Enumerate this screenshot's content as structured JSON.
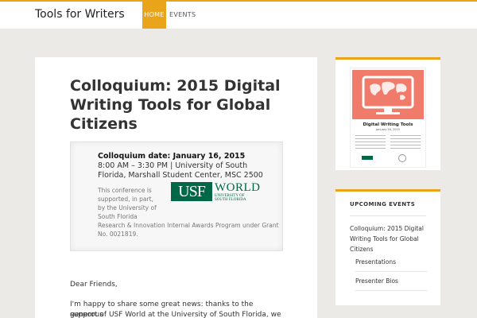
{
  "header": {
    "site_title": "Tools for Writers",
    "nav": [
      {
        "label": "HOME",
        "active": true
      },
      {
        "label": "EVENTS",
        "active": false
      }
    ]
  },
  "post": {
    "title": "Colloquium: 2015 Digital Writing Tools for Global Citizens",
    "box": {
      "date_line": "Colloquium date: January 16, 2015",
      "info_line": "8:00 AM – 3:30 PM | University of South Florida, Marshall Student Center, MSC 2500",
      "support_text_a": "This conference is supported, in part, by the University of South Florida",
      "support_text_b": "Research & Innovation Internal Awards Program under Grant No. 0021819.",
      "logo": {
        "mark": "USF",
        "world": "WORLD",
        "sub_line1": "UNIVERSITY OF",
        "sub_line2": "SOUTH FLORIDA"
      }
    },
    "greeting": "Dear Friends,",
    "paragraph_line1": "I'm happy to share some great news: thanks to the generous",
    "paragraph_line2": "support of USF World at the University of South Florida, we will be"
  },
  "sidebar": {
    "poster": {
      "title": "Digital Writing Tools",
      "date": "January 16, 2015"
    },
    "upcoming": {
      "heading": "UPCOMING EVENTS",
      "event": "Colloquium: 2015 Digital Writing Tools for Global Citizens",
      "sub_items": [
        "Presentations",
        "Presenter Bios"
      ]
    }
  },
  "colors": {
    "accent": "#e9a41a",
    "usf_green": "#006747",
    "poster_coral": "#f07b6b"
  }
}
